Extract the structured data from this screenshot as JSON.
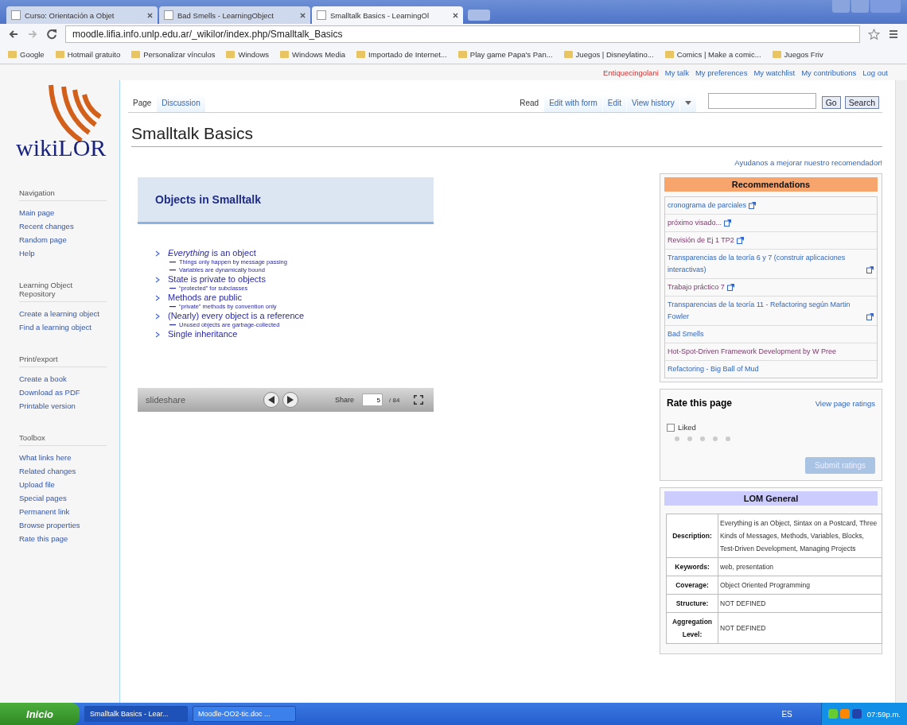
{
  "browser": {
    "tabs": [
      {
        "label": "Curso: Orientación a Objet",
        "selected": false
      },
      {
        "label": "Bad Smells - LearningObject",
        "selected": false
      },
      {
        "label": "Smalltalk Basics - LearningOl",
        "selected": true
      }
    ],
    "url": "moodle.lifia.info.unlp.edu.ar/_wikilor/index.php/Smalltalk_Basics",
    "bookmarks": [
      "Google",
      "Hotmail gratuito",
      "Personalizar vínculos",
      "Windows",
      "Windows Media",
      "Importado de Internet...",
      "Play game Papa's Pan...",
      "Juegos | Disneylatino...",
      "Comics | Make a comic...",
      "Juegos Friv"
    ]
  },
  "personal_links": [
    "Entiquecingolani",
    "My talk",
    "My preferences",
    "My watchlist",
    "My contributions",
    "Log out"
  ],
  "logo": "wikiLOR",
  "page_tabs": [
    {
      "label": "Page",
      "selected": true
    },
    {
      "label": "Discussion",
      "selected": false
    }
  ],
  "view_tabs": [
    {
      "label": "Read",
      "selected": true
    },
    {
      "label": "Edit with form",
      "selected": false
    },
    {
      "label": "Edit",
      "selected": false
    },
    {
      "label": "View history",
      "selected": false
    }
  ],
  "search": {
    "go": "Go",
    "search": "Search"
  },
  "title": "Smalltalk Basics",
  "sidebar": [
    {
      "heading": "Navigation",
      "items": [
        "Main page",
        "Recent changes",
        "Random page",
        "Help"
      ]
    },
    {
      "heading": "Learning Object Repository",
      "items": [
        "Create a learning object",
        "Find a learning object"
      ]
    },
    {
      "heading": "Print/export",
      "items": [
        "Create a book",
        "Download as PDF",
        "Printable version"
      ]
    },
    {
      "heading": "Toolbox",
      "items": [
        "What links here",
        "Related changes",
        "Upload file",
        "Special pages",
        "Permanent link",
        "Browse properties",
        "Rate this page"
      ]
    }
  ],
  "slide": {
    "title": "Objects in Smalltalk",
    "bullets": [
      {
        "text": "*Everything* is an object",
        "children": [
          "Things only happen by message passing",
          "Variables are dynamically bound"
        ]
      },
      {
        "text": "State is private to objects",
        "children": [
          "“protected” for subclasses"
        ]
      },
      {
        "text": "Methods are public",
        "children": [
          "“private” methods by convention only"
        ]
      },
      {
        "text": "(Nearly) every object is a reference",
        "children": [
          "Unused objects are garbage-collected"
        ]
      },
      {
        "text": "Single inheritance"
      }
    ],
    "player": {
      "brand": "slideshare",
      "share": "Share",
      "page": "5",
      "total": "/ 84"
    }
  },
  "help_link": "Ayudanos a mejorar nuestro recomendador!",
  "recommendations": {
    "title": "Recommendations",
    "items": [
      {
        "label": "cronograma de parciales",
        "visited": false,
        "external": true
      },
      {
        "label": "próximo visado...",
        "visited": true,
        "external": true
      },
      {
        "label": "Revisión de Ej 1 TP2",
        "visited": true,
        "external": true
      },
      {
        "label": "Transparencias de la teoría 6 y 7 (construir aplicaciones interactivas)",
        "visited": false,
        "external": true
      },
      {
        "label": "Trabajo práctico 7",
        "visited": true,
        "external": true
      },
      {
        "label": "Transparencias de la teoría 11 - Refactoring según Martin Fowler",
        "visited": false,
        "external": true
      },
      {
        "label": "Bad Smells",
        "visited": false,
        "external": false
      },
      {
        "label": "Hot-Spot-Driven Framework Development by W Pree",
        "visited": true,
        "external": false
      },
      {
        "label": "Refactoring - Big Ball of Mud",
        "visited": false,
        "external": false
      }
    ]
  },
  "rating": {
    "title": "Rate this page",
    "view_link": "View page ratings",
    "label": "Liked",
    "checked": false,
    "stars": 0,
    "submit": "Submit ratings",
    "submit_disabled": true
  },
  "lom": {
    "title": "LOM General",
    "rows": [
      {
        "label": "Description:",
        "value": "Everything is an Object, Sintax on a Postcard, Three Kinds of Messages, Methods, Variables, Blocks, Test-Driven Development, Managing Projects"
      },
      {
        "label": "Keywords:",
        "value": "web, presentation"
      },
      {
        "label": "Coverage:",
        "value": "Object Oriented Programming"
      },
      {
        "label": "Structure:",
        "value": "NOT DEFINED"
      },
      {
        "label": "Aggregation Level:",
        "value": "NOT DEFINED"
      }
    ]
  },
  "taskbar": {
    "start": "Inicio",
    "tasks": [
      {
        "label": "Smalltalk Basics - Lear...",
        "selected": true
      },
      {
        "label": "Moodle-OO2-tic.doc ...",
        "selected": false
      }
    ],
    "language": "ES",
    "time": "07:59p.m."
  }
}
